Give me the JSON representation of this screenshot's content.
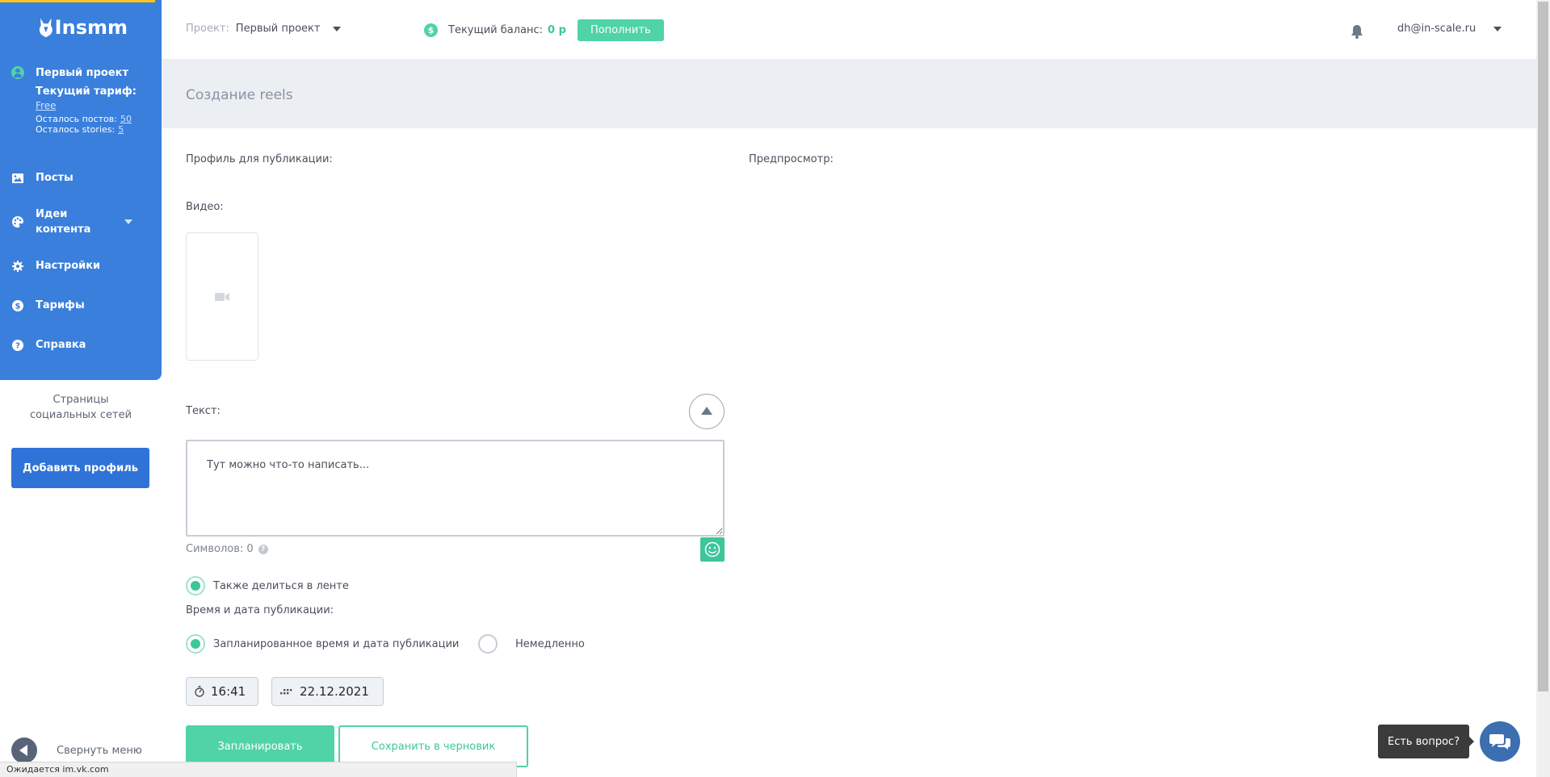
{
  "sidebar": {
    "logo_text": "Insmm",
    "project_name": "Первый проект",
    "tariff_label": "Текущий тариф:",
    "tariff_value": "Free",
    "posts_left_label": "Осталось постов:",
    "posts_left_value": "50",
    "stories_left_label": "Осталось stories:",
    "stories_left_value": "5",
    "nav": [
      {
        "label": "Посты",
        "icon": "image-icon"
      },
      {
        "label": "Идеи контента",
        "icon": "palette-icon"
      },
      {
        "label": "Настройки",
        "icon": "gear-icon"
      },
      {
        "label": "Тарифы",
        "icon": "dollar-icon"
      },
      {
        "label": "Справка",
        "icon": "question-icon"
      }
    ],
    "social_pages_title": "Страницы социальных сетей",
    "add_profile": "Добавить профиль",
    "collapse_label": "Свернуть меню",
    "accent_color": "#3a7fdc"
  },
  "header": {
    "project_label": "Проект:",
    "project_value": "Первый проект",
    "balance_label": "Текущий баланс:",
    "balance_value": "0 р",
    "topup_button": "Пополнить",
    "user_email": "dh@in-scale.ru"
  },
  "page": {
    "title": "Создание reels",
    "profile_label": "Профиль для публикации:",
    "preview_label": "Предпросмотр:",
    "video_label": "Видео:",
    "text_label": "Текст:",
    "text_placeholder": "Тут можно что-то написать...",
    "chars_label": "Символов: 0",
    "share_feed": "Также делиться в ленте",
    "publish_time_label": "Время и дата публикации:",
    "scheduled_option": "Запланированное время и дата публикации",
    "immediate_option": "Немедленно",
    "time_value": "16:41",
    "date_value": "22.12.2021",
    "schedule_button": "Запланировать",
    "draft_button": "Сохранить в черновик"
  },
  "widget": {
    "question_label": "Есть вопрос?"
  },
  "status_bar": {
    "text": "Ожидается im.vk.com"
  },
  "colors": {
    "green": "#4fd3a7",
    "blue": "#3a7fdc"
  }
}
